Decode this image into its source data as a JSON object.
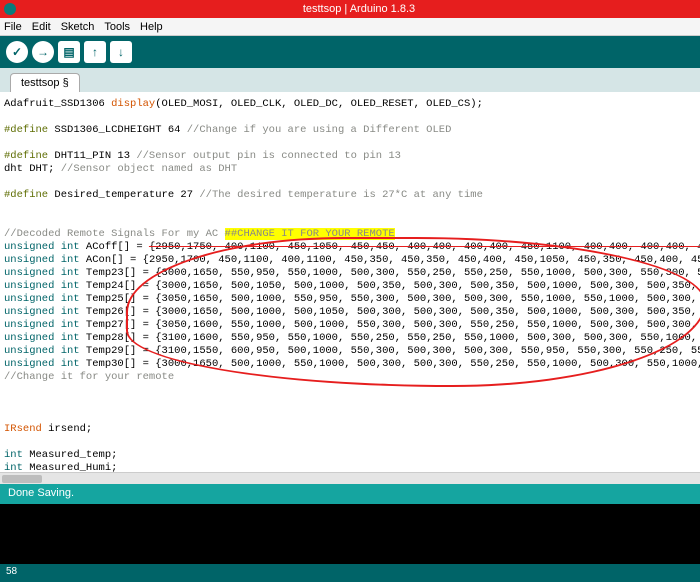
{
  "titlebar": {
    "title": "testtsop | Arduino 1.8.3"
  },
  "menubar": {
    "items": [
      "File",
      "Edit",
      "Sketch",
      "Tools",
      "Help"
    ]
  },
  "tab": {
    "name": "testtsop §"
  },
  "status": {
    "text": "Done Saving."
  },
  "footer": {
    "line": "58"
  },
  "code": {
    "l1a": "Adafruit_SSD1306 ",
    "l1b": "display",
    "l1c": "(OLED_MOSI, OLED_CLK, OLED_DC, OLED_RESET, OLED_CS);",
    "define": "#define",
    "l3b": " SSD1306_LCDHEIGHT 64 ",
    "l3c": "//Change if you are using a Different OLED",
    "l5b": " DHT11_PIN 13 ",
    "l5c": "//Sensor output pin is connected to pin 13",
    "l6a": "dht DHT; ",
    "l6b": "//Sensor object named as DHT",
    "l8b": " Desired_temperature 27 ",
    "l8c": "//The desired temperature is 27*C at any time",
    "l10": "//Decoded Remote Signals For my AC ",
    "l10h": "##CHANGE IT FOR YOUR REMOTE",
    "unsigned_int": "unsigned int",
    "acoff_name": " ACoff[] = ",
    "acoff_vals": "{2950,1750, 400,1100, 450,1050, 450,450, 400,400, 400,400, 450,1100, 400,400, 400,400, 450,1100, 400,1100, 450,",
    "acon_name": " ACon[] = ",
    "acon_vals": "{2950,1700, 450,1100, 400,1100, 450,350, 450,350, 450,400, 450,1050, 450,350, 450,400, 450,1050, 450,1100, 400,4",
    "t23_name": " Temp23[] = ",
    "t23_vals": "{3000,1650, 550,950, 550,1000, 500,300, 550,250, 550,250, 550,1000, 500,300, 550,300, 500,1000, 550,950, 550,3",
    "t24_name": " Temp24[] = ",
    "t24_vals": "{3000,1650, 500,1050, 500,1000, 500,350, 500,300, 500,350, 500,1000, 500,300, 500,350, 500,1000, 550,950, 550,",
    "t25_name": " Temp25[] = ",
    "t25_vals": "{3050,1650, 500,1000, 550,950, 550,300, 500,300, 500,300, 550,1000, 550,1000, 500,300, 500,1000, 550,950, 550,2",
    "t26_name": " Temp26[] = ",
    "t26_vals": "{3000,1650, 500,1000, 500,1050, 500,300, 500,300, 500,350, 500,1000, 500,300, 500,350, 500,1000, 500,1050, 500,",
    "t27_name": " Temp27[] = ",
    "t27_vals": "{3050,1600, 550,1000, 500,1000, 550,300, 500,300, 550,250, 550,1000, 500,300, 500,300, 550,300, 500,1000, 550,1",
    "t28_name": " Temp28[] = ",
    "t28_vals": "{3100,1600, 550,950, 550,1000, 550,250, 550,250, 550,1000, 500,300, 500,300, 550,1000, 550,1000, 500,1000, 550,",
    "t29_name": " Temp29[] = ",
    "t29_vals": "{3100,1550, 600,950, 500,1000, 550,300, 500,300, 500,300, 550,950, 550,300, 550,250, 550,1000, 500,1000, 550,2",
    "t30_name": " Temp30[] = ",
    "t30_vals": "{3000,1650, 500,1000, 550,1000, 500,300, 500,300, 550,250, 550,1000, 500,300, 550,1000, 550,950, 550,950, 550,3",
    "l22": "//Change it for your remote",
    "int": "int",
    "irsend_type": "IRsend",
    "irsend_var": " irsend;",
    "mtemp": " Measured_temp;",
    "mhumi": " Measured_Humi;"
  }
}
